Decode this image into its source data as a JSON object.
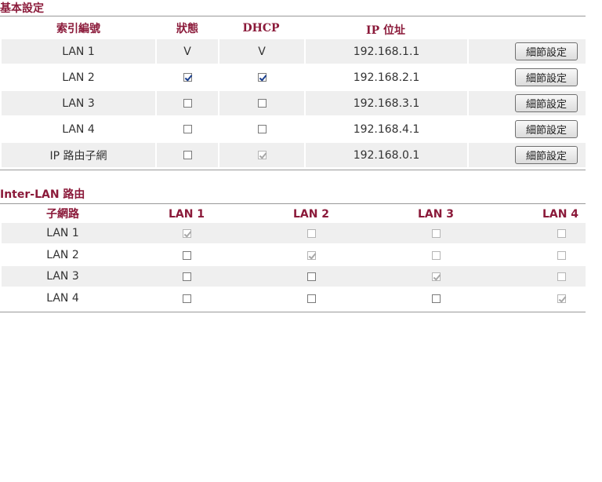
{
  "basic": {
    "title": "基本設定",
    "headers": {
      "index": "索引編號",
      "status": "狀態",
      "dhcp": "DHCP",
      "ip": "IP 位址"
    },
    "rows": [
      {
        "name": "LAN 1",
        "status_text": "V",
        "dhcp_text": "V",
        "ip": "192.168.1.1",
        "button": "細節設定"
      },
      {
        "name": "LAN 2",
        "status_checked": true,
        "dhcp_checked": true,
        "ip": "192.168.2.1",
        "button": "細節設定"
      },
      {
        "name": "LAN 3",
        "status_checked": false,
        "dhcp_checked": false,
        "ip": "192.168.3.1",
        "button": "細節設定"
      },
      {
        "name": "LAN 4",
        "status_checked": false,
        "dhcp_checked": false,
        "ip": "192.168.4.1",
        "button": "細節設定"
      },
      {
        "name": "IP 路由子網",
        "status_checked": false,
        "dhcp_checked": true,
        "dhcp_disabled": true,
        "ip": "192.168.0.1",
        "button": "細節設定"
      }
    ]
  },
  "interlan": {
    "title": "Inter-LAN 路由",
    "headers": {
      "subnet": "子網路",
      "lan1": "LAN 1",
      "lan2": "LAN 2",
      "lan3": "LAN 3",
      "lan4": "LAN 4"
    },
    "rows": [
      {
        "name": "LAN 1",
        "checks": [
          true,
          false,
          false,
          false
        ],
        "disabled": [
          true,
          true,
          true,
          true
        ]
      },
      {
        "name": "LAN 2",
        "checks": [
          false,
          true,
          false,
          false
        ],
        "disabled": [
          false,
          true,
          true,
          true
        ]
      },
      {
        "name": "LAN 3",
        "checks": [
          false,
          false,
          true,
          false
        ],
        "disabled": [
          false,
          false,
          true,
          true
        ]
      },
      {
        "name": "LAN 4",
        "checks": [
          false,
          false,
          false,
          true
        ],
        "disabled": [
          false,
          false,
          false,
          true
        ]
      }
    ]
  }
}
